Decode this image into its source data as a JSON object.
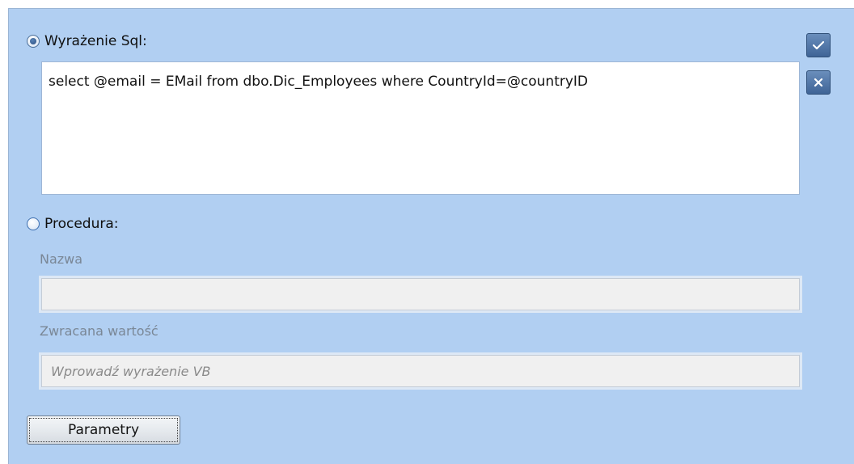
{
  "sql_option": {
    "label": "Wyrażenie Sql:",
    "selected": true,
    "query": "select @email = EMail from dbo.Dic_Employees where CountryId=@countryID"
  },
  "procedure_option": {
    "label": "Procedura:",
    "selected": false,
    "name_label": "Nazwa",
    "name_value": "",
    "return_label": "Zwracana wartość",
    "return_placeholder": "Wprowadź wyrażenie VB"
  },
  "side_buttons": {
    "accept_icon": "checkmark-icon",
    "cancel_icon": "close-icon"
  },
  "buttons": {
    "parameters_label": "Parametry"
  },
  "colors": {
    "panel_background": "#b1cff2",
    "side_button": "#4a6fa0"
  }
}
